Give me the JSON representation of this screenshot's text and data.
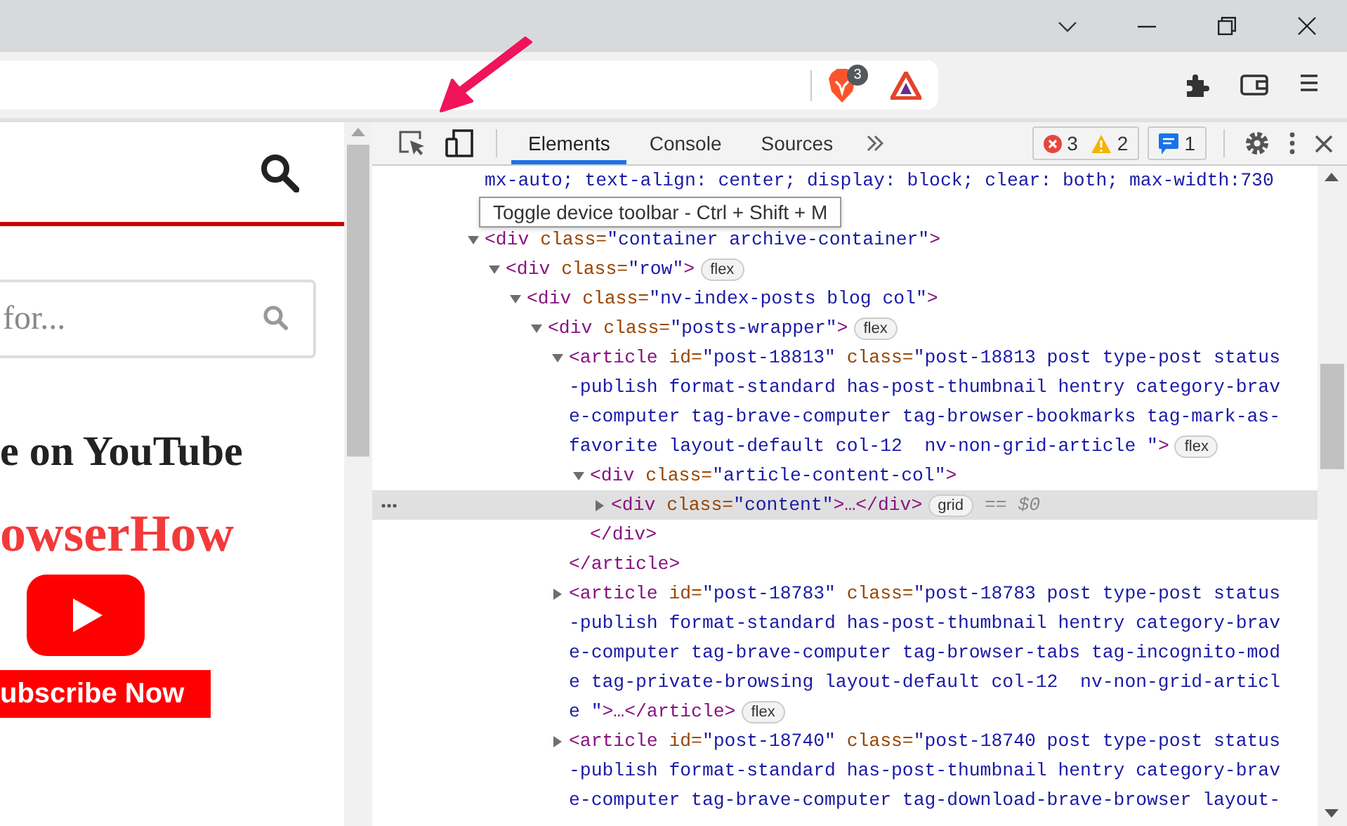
{
  "browser": {
    "shields_count": "3"
  },
  "page": {
    "search_placeholder": "for...",
    "heading": "e on YouTube",
    "brand": "owserHow",
    "subscribe_button": "ubscribe Now"
  },
  "devtools": {
    "tabs": [
      {
        "label": "Elements",
        "selected": true
      },
      {
        "label": "Console",
        "selected": false
      },
      {
        "label": "Sources",
        "selected": false
      }
    ],
    "issues": {
      "errors": "3",
      "warnings": "2",
      "messages": "1"
    },
    "tooltip": "Toggle device toolbar - Ctrl + Shift + M",
    "dom": {
      "lead_line": [
        {
          "kind": "value",
          "text": "mx-auto; text-align: center; display: block; clear: both; max-width:730"
        }
      ],
      "nodes": [
        {
          "expanded": true,
          "selected": false,
          "lines": [
            [
              {
                "kind": "tag",
                "text": "<div"
              },
              {
                "kind": "name",
                "text": " class="
              },
              {
                "kind": "value",
                "text": "\"container archive-container\""
              },
              {
                "kind": "tag",
                "text": ">"
              }
            ]
          ],
          "children": [
            {
              "expanded": true,
              "selected": false,
              "badge": "flex",
              "lines": [
                [
                  {
                    "kind": "tag",
                    "text": "<div"
                  },
                  {
                    "kind": "name",
                    "text": " class="
                  },
                  {
                    "kind": "value",
                    "text": "\"row\""
                  },
                  {
                    "kind": "tag",
                    "text": ">"
                  }
                ]
              ],
              "children": [
                {
                  "expanded": true,
                  "selected": false,
                  "lines": [
                    [
                      {
                        "kind": "tag",
                        "text": "<div"
                      },
                      {
                        "kind": "name",
                        "text": " class="
                      },
                      {
                        "kind": "value",
                        "text": "\"nv-index-posts blog col\""
                      },
                      {
                        "kind": "tag",
                        "text": ">"
                      }
                    ]
                  ],
                  "children": [
                    {
                      "expanded": true,
                      "selected": false,
                      "badge": "flex",
                      "lines": [
                        [
                          {
                            "kind": "tag",
                            "text": "<div"
                          },
                          {
                            "kind": "name",
                            "text": " class="
                          },
                          {
                            "kind": "value",
                            "text": "\"posts-wrapper\""
                          },
                          {
                            "kind": "tag",
                            "text": ">"
                          }
                        ]
                      ],
                      "children": [
                        {
                          "expanded": true,
                          "selected": false,
                          "badge": "flex",
                          "close": "</article>",
                          "lines": [
                            [
                              {
                                "kind": "tag",
                                "text": "<article"
                              },
                              {
                                "kind": "name",
                                "text": " id="
                              },
                              {
                                "kind": "value",
                                "text": "\"post-18813\""
                              },
                              {
                                "kind": "name",
                                "text": " class="
                              },
                              {
                                "kind": "value",
                                "text": "\"post-18813 post type-post status"
                              }
                            ],
                            [
                              {
                                "kind": "value",
                                "text": "-publish format-standard has-post-thumbnail hentry category-brav"
                              }
                            ],
                            [
                              {
                                "kind": "value",
                                "text": "e-computer tag-brave-computer tag-browser-bookmarks tag-mark-as-"
                              }
                            ],
                            [
                              {
                                "kind": "value",
                                "text": "favorite layout-default col-12  nv-non-grid-article \""
                              },
                              {
                                "kind": "tag",
                                "text": ">"
                              }
                            ]
                          ],
                          "children": [
                            {
                              "expanded": true,
                              "selected": false,
                              "close": "</div>",
                              "lines": [
                                [
                                  {
                                    "kind": "tag",
                                    "text": "<div"
                                  },
                                  {
                                    "kind": "name",
                                    "text": " class="
                                  },
                                  {
                                    "kind": "value",
                                    "text": "\"article-content-col\""
                                  },
                                  {
                                    "kind": "tag",
                                    "text": ">"
                                  }
                                ]
                              ],
                              "children": [
                                {
                                  "expanded": false,
                                  "selected": true,
                                  "badge": "grid",
                                  "marker": "== $0",
                                  "lines": [
                                    [
                                      {
                                        "kind": "tag",
                                        "text": "<div"
                                      },
                                      {
                                        "kind": "name",
                                        "text": " class="
                                      },
                                      {
                                        "kind": "value",
                                        "text": "\"content\""
                                      },
                                      {
                                        "kind": "tag",
                                        "text": ">…</div>"
                                      }
                                    ]
                                  ]
                                }
                              ]
                            }
                          ]
                        },
                        {
                          "expanded": false,
                          "selected": false,
                          "badge": "flex",
                          "lines": [
                            [
                              {
                                "kind": "tag",
                                "text": "<article"
                              },
                              {
                                "kind": "name",
                                "text": " id="
                              },
                              {
                                "kind": "value",
                                "text": "\"post-18783\""
                              },
                              {
                                "kind": "name",
                                "text": " class="
                              },
                              {
                                "kind": "value",
                                "text": "\"post-18783 post type-post status"
                              }
                            ],
                            [
                              {
                                "kind": "value",
                                "text": "-publish format-standard has-post-thumbnail hentry category-brav"
                              }
                            ],
                            [
                              {
                                "kind": "value",
                                "text": "e-computer tag-brave-computer tag-browser-tabs tag-incognito-mod"
                              }
                            ],
                            [
                              {
                                "kind": "value",
                                "text": "e tag-private-browsing layout-default col-12  nv-non-grid-articl"
                              }
                            ],
                            [
                              {
                                "kind": "value",
                                "text": "e \""
                              },
                              {
                                "kind": "tag",
                                "text": ">…</article>"
                              }
                            ]
                          ]
                        },
                        {
                          "expanded": false,
                          "selected": false,
                          "lines": [
                            [
                              {
                                "kind": "tag",
                                "text": "<article"
                              },
                              {
                                "kind": "name",
                                "text": " id="
                              },
                              {
                                "kind": "value",
                                "text": "\"post-18740\""
                              },
                              {
                                "kind": "name",
                                "text": " class="
                              },
                              {
                                "kind": "value",
                                "text": "\"post-18740 post type-post status"
                              }
                            ],
                            [
                              {
                                "kind": "value",
                                "text": "-publish format-standard has-post-thumbnail hentry category-brav"
                              }
                            ],
                            [
                              {
                                "kind": "value",
                                "text": "e-computer tag-brave-computer tag-download-brave-browser layout-"
                              }
                            ]
                          ]
                        }
                      ]
                    }
                  ]
                }
              ]
            }
          ]
        }
      ]
    }
  }
}
